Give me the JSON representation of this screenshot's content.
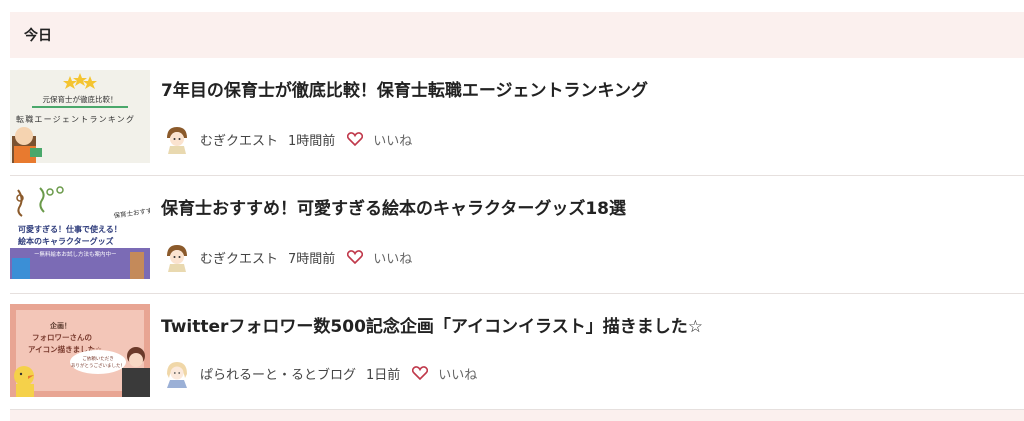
{
  "section": {
    "title": "今日"
  },
  "articles": [
    {
      "title": "7年目の保育士が徹底比較！保育士転職エージェントランキング",
      "author": "むぎクエスト",
      "time": "1時間前",
      "like_label": "いいね",
      "thumb": {
        "top_label": "元保育士が徹底比較！",
        "main_label": "転職エージェントランキング"
      }
    },
    {
      "title": "保育士おすすめ！可愛すぎる絵本のキャラクターグッズ18選",
      "author": "むぎクエスト",
      "time": "7時間前",
      "like_label": "いいね",
      "thumb": {
        "corner_label": "保育士おすすめ",
        "line1": "可愛すぎる！仕事で使える！",
        "line2": "絵本のキャラクターグッズ",
        "line3": "ー無料絵本お試し方法も案内中ー"
      }
    },
    {
      "title": "Twitterフォロワー数500記念企画「アイコンイラスト」描きました☆",
      "author": "ぱられるーと・るとブログ",
      "time": "1日前",
      "like_label": "いいね",
      "thumb": {
        "badge": "企画！",
        "line1": "フォロワーさんの",
        "line2": "アイコン描きました☆",
        "bubble1": "ご依頼いただき",
        "bubble2": "ありがとうございました！"
      }
    }
  ],
  "colors": {
    "header_bg": "#fbf0ee",
    "heart": "#c0394b",
    "divider": "#e6e0de"
  }
}
